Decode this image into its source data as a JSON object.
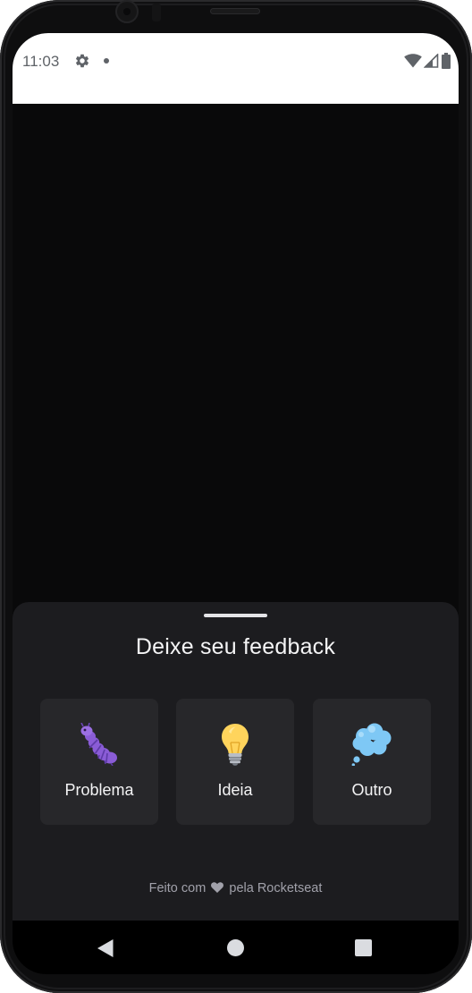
{
  "status_bar": {
    "time": "11:03",
    "icons": [
      "gear-icon",
      "notification-dot-icon",
      "wifi-icon",
      "cellular-signal-icon",
      "battery-icon"
    ]
  },
  "sheet": {
    "title": "Deixe seu feedback",
    "options": [
      {
        "label": "Problema",
        "icon": "bug-icon"
      },
      {
        "label": "Ideia",
        "icon": "lightbulb-icon"
      },
      {
        "label": "Outro",
        "icon": "thought-bubble-icon"
      }
    ],
    "footer": {
      "prefix": "Feito com",
      "icon": "heart-icon",
      "suffix": "pela Rocketseat"
    }
  },
  "nav_bar": {
    "buttons": [
      "back-icon",
      "home-icon",
      "recents-icon"
    ]
  },
  "colors": {
    "sheet_background": "#1c1c1f",
    "card_background": "#27272a",
    "app_background": "#09090a",
    "title_text": "#f4f4f5",
    "footer_text": "#a1a1aa"
  }
}
